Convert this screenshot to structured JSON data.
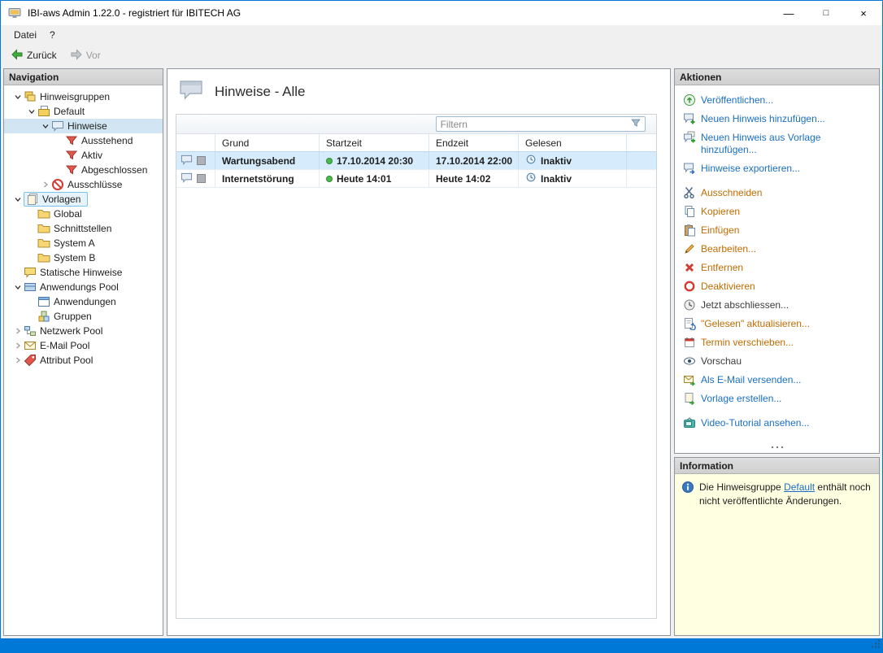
{
  "window": {
    "title": "IBI-aws Admin 1.22.0 - registriert für IBITECH AG",
    "controls": {
      "minimize": "—",
      "maximize": "□",
      "close": "×"
    }
  },
  "menu": {
    "items": [
      {
        "label": "Datei"
      },
      {
        "label": "?"
      }
    ]
  },
  "toolbar": {
    "back_label": "Zurück",
    "forward_label": "Vor"
  },
  "navigation": {
    "header": "Navigation",
    "items": [
      {
        "label": "Hinweisgruppen",
        "level": 0,
        "expander": "down"
      },
      {
        "label": "Default",
        "level": 1,
        "expander": "down"
      },
      {
        "label": "Hinweise",
        "level": 2,
        "expander": "down",
        "selected": true
      },
      {
        "label": "Ausstehend",
        "level": 3
      },
      {
        "label": "Aktiv",
        "level": 3
      },
      {
        "label": "Abgeschlossen",
        "level": 3
      },
      {
        "label": "Ausschlüsse",
        "level": 2,
        "expander": "right"
      },
      {
        "label": "Vorlagen",
        "level": 0,
        "expander": "down",
        "highlighted": true
      },
      {
        "label": "Global",
        "level": 1
      },
      {
        "label": "Schnittstellen",
        "level": 1
      },
      {
        "label": "System A",
        "level": 1
      },
      {
        "label": "System B",
        "level": 1
      },
      {
        "label": "Statische Hinweise",
        "level": 0
      },
      {
        "label": "Anwendungs Pool",
        "level": 0,
        "expander": "down"
      },
      {
        "label": "Anwendungen",
        "level": 1
      },
      {
        "label": "Gruppen",
        "level": 1
      },
      {
        "label": "Netzwerk Pool",
        "level": 0,
        "expander": "right"
      },
      {
        "label": "E-Mail Pool",
        "level": 0,
        "expander": "right"
      },
      {
        "label": "Attribut Pool",
        "level": 0,
        "expander": "right"
      }
    ]
  },
  "main": {
    "title": "Hinweise - Alle",
    "filter": {
      "placeholder": "Filtern"
    },
    "table": {
      "columns": [
        "",
        "Grund",
        "Startzeit",
        "Endzeit",
        "Gelesen"
      ],
      "rows": [
        {
          "grund": "Wartungsabend",
          "startzeit": "17.10.2014 20:30",
          "endzeit": "17.10.2014 22:00",
          "gelesen": "Inaktiv",
          "selected": true
        },
        {
          "grund": "Internetstörung",
          "startzeit": "Heute 14:01",
          "endzeit": "Heute 14:02",
          "gelesen": "Inaktiv",
          "selected": false
        }
      ]
    }
  },
  "actions": {
    "header": "Aktionen",
    "items": [
      {
        "label": "Veröffentlichen...",
        "color": "blue"
      },
      {
        "label": "Neuen Hinweis hinzufügen...",
        "color": "blue"
      },
      {
        "label": "Neuen Hinweis aus Vorlage hinzufügen...",
        "color": "blue"
      },
      {
        "label": "Hinweise exportieren...",
        "color": "blue"
      },
      {
        "label": "Ausschneiden",
        "color": "orange"
      },
      {
        "label": "Kopieren",
        "color": "orange"
      },
      {
        "label": "Einfügen",
        "color": "orange"
      },
      {
        "label": "Bearbeiten...",
        "color": "orange"
      },
      {
        "label": "Entfernen",
        "color": "orange"
      },
      {
        "label": "Deaktivieren",
        "color": "orange"
      },
      {
        "label": "Jetzt abschliessen...",
        "color": "dark"
      },
      {
        "label": "\"Gelesen\" aktualisieren...",
        "color": "orange"
      },
      {
        "label": "Termin verschieben...",
        "color": "orange"
      },
      {
        "label": "Vorschau",
        "color": "dark"
      },
      {
        "label": "Als E-Mail versenden...",
        "color": "blue"
      },
      {
        "label": "Vorlage erstellen...",
        "color": "blue"
      },
      {
        "label": "Video-Tutorial ansehen...",
        "color": "blue"
      }
    ]
  },
  "information": {
    "header": "Information",
    "text_before": "Die Hinweisgruppe ",
    "link": "Default",
    "text_after": " enthält noch nicht veröffentlichte Änderungen."
  },
  "colors": {
    "accent_blue": "#0078d7",
    "link_blue": "#1a6fc4",
    "link_orange": "#c06c00",
    "link_dark": "#3c3c3c",
    "info_background": "#ffffe1",
    "selected_row": "#d6ebfc",
    "selected_tree_item": "#d2e5f3"
  }
}
